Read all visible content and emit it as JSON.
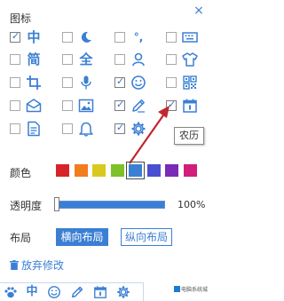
{
  "panel": {
    "section_title": "图标",
    "close_symbol": "×"
  },
  "icons": [
    {
      "name": "chinese-char-icon",
      "glyph": "中",
      "checked": true
    },
    {
      "name": "moon-icon",
      "glyph": "",
      "checked": false
    },
    {
      "name": "punctuation-icon",
      "glyph": "°,",
      "checked": false
    },
    {
      "name": "keyboard-icon",
      "glyph": "",
      "checked": false
    },
    {
      "name": "simplified-icon",
      "glyph": "简",
      "checked": false
    },
    {
      "name": "full-width-icon",
      "glyph": "全",
      "checked": false
    },
    {
      "name": "user-icon",
      "glyph": "",
      "checked": false
    },
    {
      "name": "skin-icon",
      "glyph": "",
      "checked": false
    },
    {
      "name": "crop-icon",
      "glyph": "",
      "checked": false
    },
    {
      "name": "microphone-icon",
      "glyph": "",
      "checked": false
    },
    {
      "name": "smiley-icon",
      "glyph": "",
      "checked": true
    },
    {
      "name": "qrcode-icon",
      "glyph": "",
      "checked": false
    },
    {
      "name": "mail-icon",
      "glyph": "",
      "checked": false
    },
    {
      "name": "image-icon",
      "glyph": "",
      "checked": false
    },
    {
      "name": "pencil-icon",
      "glyph": "",
      "checked": true
    },
    {
      "name": "calendar-icon",
      "glyph": "",
      "checked": true
    },
    {
      "name": "document-icon",
      "glyph": "",
      "checked": false
    },
    {
      "name": "bell-icon",
      "glyph": "",
      "checked": false
    },
    {
      "name": "gear-icon",
      "glyph": "",
      "checked": true
    }
  ],
  "tooltip": {
    "text": "农历"
  },
  "color_row": {
    "label": "颜色",
    "swatches": [
      "#d8232a",
      "#f27c1e",
      "#d9c91e",
      "#7ec12a",
      "#3b7fd4",
      "#4a4fd1",
      "#7a2bb5",
      "#d21e7a"
    ],
    "selected_index": 4
  },
  "opacity_row": {
    "label": "透明度",
    "value_text": "100%",
    "value": 1.0
  },
  "layout_row": {
    "label": "布局",
    "horizontal_label": "横向布局",
    "vertical_label": "纵向布局"
  },
  "reset": {
    "label": "放弃修改"
  },
  "toolbar": {
    "items": [
      "paw-icon",
      "chinese-char-icon",
      "smiley-icon",
      "pencil-icon",
      "calendar-icon",
      "gear-icon"
    ],
    "chinese_glyph": "中"
  },
  "watermark": {
    "text": "电脑系统城"
  },
  "colors": {
    "accent": "#3b7fd4",
    "arrow": "#c0282d"
  }
}
